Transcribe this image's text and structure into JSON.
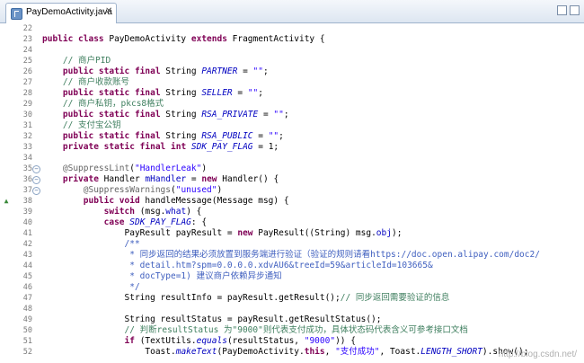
{
  "tab": {
    "title": "PayDemoActivity.java",
    "close": "✕"
  },
  "watermark": "http://blog.csdn.net/",
  "lines": [
    {
      "n": "22",
      "t": []
    },
    {
      "n": "23",
      "t": [
        [
          "kw",
          "public class "
        ],
        [
          "p",
          "PayDemoActivity "
        ],
        [
          "kw",
          "extends "
        ],
        [
          "p",
          "FragmentActivity {"
        ]
      ]
    },
    {
      "n": "24",
      "t": []
    },
    {
      "n": "25",
      "t": [
        [
          "p",
          "    "
        ],
        [
          "cm",
          "// 商户PID"
        ]
      ]
    },
    {
      "n": "26",
      "t": [
        [
          "p",
          "    "
        ],
        [
          "kw",
          "public static final "
        ],
        [
          "p",
          "String "
        ],
        [
          "fd",
          "PARTNER"
        ],
        [
          "p",
          " = "
        ],
        [
          "st",
          "\"\""
        ],
        [
          "p",
          ";"
        ]
      ]
    },
    {
      "n": "27",
      "t": [
        [
          "p",
          "    "
        ],
        [
          "cm",
          "// 商户收款账号"
        ]
      ]
    },
    {
      "n": "28",
      "t": [
        [
          "p",
          "    "
        ],
        [
          "kw",
          "public static final "
        ],
        [
          "p",
          "String "
        ],
        [
          "fd",
          "SELLER"
        ],
        [
          "p",
          " = "
        ],
        [
          "st",
          "\"\""
        ],
        [
          "p",
          ";"
        ]
      ]
    },
    {
      "n": "29",
      "t": [
        [
          "p",
          "    "
        ],
        [
          "cm",
          "// 商户私钥，pkcs8格式"
        ]
      ]
    },
    {
      "n": "30",
      "t": [
        [
          "p",
          "    "
        ],
        [
          "kw",
          "public static final "
        ],
        [
          "p",
          "String "
        ],
        [
          "fd",
          "RSA_PRIVATE"
        ],
        [
          "p",
          " = "
        ],
        [
          "st",
          "\"\""
        ],
        [
          "p",
          ";"
        ]
      ]
    },
    {
      "n": "31",
      "t": [
        [
          "p",
          "    "
        ],
        [
          "cm",
          "// 支付宝公钥"
        ]
      ]
    },
    {
      "n": "32",
      "t": [
        [
          "p",
          "    "
        ],
        [
          "kw",
          "public static final "
        ],
        [
          "p",
          "String "
        ],
        [
          "fd",
          "RSA_PUBLIC"
        ],
        [
          "p",
          " = "
        ],
        [
          "st",
          "\"\""
        ],
        [
          "p",
          ";"
        ]
      ]
    },
    {
      "n": "33",
      "t": [
        [
          "p",
          "    "
        ],
        [
          "kw",
          "private static final int "
        ],
        [
          "fd",
          "SDK_PAY_FLAG"
        ],
        [
          "p",
          " = 1;"
        ]
      ]
    },
    {
      "n": "34",
      "t": []
    },
    {
      "n": "35",
      "fold": "⊖",
      "t": [
        [
          "p",
          "    "
        ],
        [
          "an",
          "@SuppressLint"
        ],
        [
          "p",
          "("
        ],
        [
          "st",
          "\"HandlerLeak\""
        ],
        [
          "p",
          ")"
        ]
      ]
    },
    {
      "n": "36",
      "fold": "⊖",
      "t": [
        [
          "p",
          "    "
        ],
        [
          "kw",
          "private "
        ],
        [
          "p",
          "Handler "
        ],
        [
          "fp",
          "mHandler"
        ],
        [
          "p",
          " = "
        ],
        [
          "kw",
          "new "
        ],
        [
          "p",
          "Handler() {"
        ]
      ]
    },
    {
      "n": "37",
      "fold": "⊖",
      "t": [
        [
          "p",
          "        "
        ],
        [
          "an",
          "@SuppressWarnings"
        ],
        [
          "p",
          "("
        ],
        [
          "st",
          "\"unused\""
        ],
        [
          "p",
          ")"
        ]
      ]
    },
    {
      "n": "38",
      "marker": "▲",
      "t": [
        [
          "p",
          "        "
        ],
        [
          "kw",
          "public void "
        ],
        [
          "p",
          "handleMessage(Message msg) {"
        ]
      ]
    },
    {
      "n": "39",
      "t": [
        [
          "p",
          "            "
        ],
        [
          "kw",
          "switch "
        ],
        [
          "p",
          "(msg."
        ],
        [
          "fp",
          "what"
        ],
        [
          "p",
          ") {"
        ]
      ]
    },
    {
      "n": "40",
      "t": [
        [
          "p",
          "            "
        ],
        [
          "kw",
          "case "
        ],
        [
          "cn",
          "SDK_PAY_FLAG"
        ],
        [
          "p",
          ": {"
        ]
      ]
    },
    {
      "n": "41",
      "t": [
        [
          "p",
          "                PayResult payResult = "
        ],
        [
          "kw",
          "new "
        ],
        [
          "p",
          "PayResult((String) msg."
        ],
        [
          "fp",
          "obj"
        ],
        [
          "p",
          ");"
        ]
      ]
    },
    {
      "n": "42",
      "t": [
        [
          "p",
          "                "
        ],
        [
          "lk",
          "/**"
        ]
      ]
    },
    {
      "n": "43",
      "t": [
        [
          "p",
          "                 "
        ],
        [
          "lk",
          "* 同步返回的结果必须放置到服务端进行验证（验证的规则请看https://doc.open.alipay.com/doc2/"
        ]
      ]
    },
    {
      "n": "44",
      "t": [
        [
          "p",
          "                 "
        ],
        [
          "lk",
          "* detail.htm?spm=0.0.0.0.xdvAU6&treeId=59&articleId=103665&"
        ]
      ]
    },
    {
      "n": "45",
      "t": [
        [
          "p",
          "                 "
        ],
        [
          "lk",
          "* docType=1) 建议商户依赖异步通知"
        ]
      ]
    },
    {
      "n": "46",
      "t": [
        [
          "p",
          "                 "
        ],
        [
          "lk",
          "*/"
        ]
      ]
    },
    {
      "n": "47",
      "t": [
        [
          "p",
          "                String resultInfo = payResult.getResult();"
        ],
        [
          "cm",
          "// 同步返回需要验证的信息"
        ]
      ]
    },
    {
      "n": "48",
      "t": []
    },
    {
      "n": "49",
      "t": [
        [
          "p",
          "                String resultStatus = payResult.getResultStatus();"
        ]
      ]
    },
    {
      "n": "50",
      "t": [
        [
          "p",
          "                "
        ],
        [
          "cm",
          "// 判断resultStatus 为\"9000\"则代表支付成功，具体状态码代表含义可参考接口文档"
        ]
      ]
    },
    {
      "n": "51",
      "t": [
        [
          "p",
          "                "
        ],
        [
          "kw",
          "if "
        ],
        [
          "p",
          "(TextUtils."
        ],
        [
          "cn",
          "equals"
        ],
        [
          "p",
          "(resultStatus, "
        ],
        [
          "st",
          "\"9000\""
        ],
        [
          "p",
          ")) {"
        ]
      ]
    },
    {
      "n": "52",
      "t": [
        [
          "p",
          "                    Toast."
        ],
        [
          "cn",
          "makeText"
        ],
        [
          "p",
          "(PayDemoActivity."
        ],
        [
          "kw",
          "this"
        ],
        [
          "p",
          ", "
        ],
        [
          "st",
          "\"支付成功\""
        ],
        [
          "p",
          ", Toast."
        ],
        [
          "cn",
          "LENGTH_SHORT"
        ],
        [
          "p",
          ").show();"
        ]
      ]
    }
  ]
}
